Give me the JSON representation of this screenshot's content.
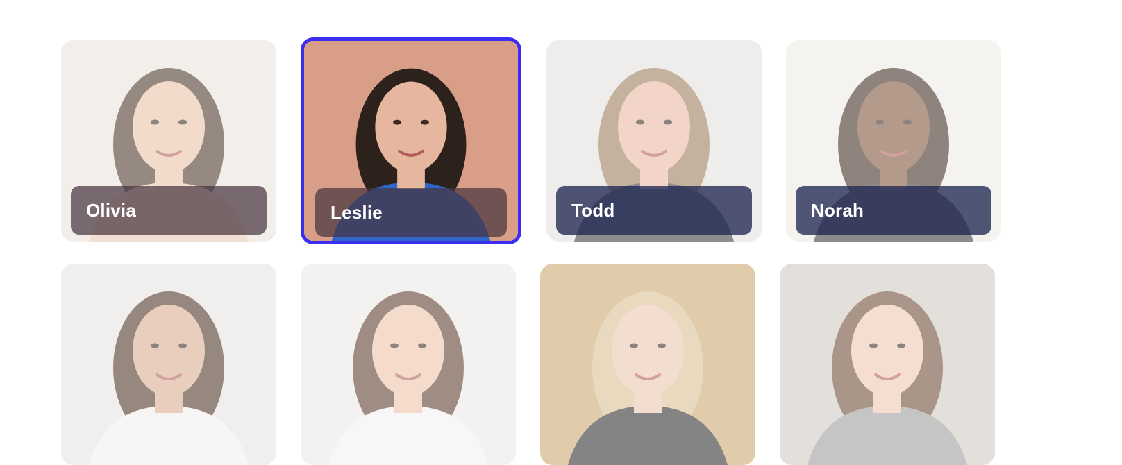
{
  "avatars": [
    {
      "name": "Olivia",
      "selected": false,
      "bg": "#e9e3dd",
      "hair": "#4a3426",
      "skin": "#e9c2a6",
      "top": "#e8cbb3"
    },
    {
      "name": "Leslie",
      "selected": true,
      "bg": "#d99e87",
      "hair": "#2d211b",
      "skin": "#e7b69e",
      "top": "#2f66c8"
    },
    {
      "name": "Todd",
      "selected": false,
      "bg": "#e3e1dc",
      "hair": "#9a7b59",
      "skin": "#e9b7a0",
      "top": "#3c3c3c"
    },
    {
      "name": "Norah",
      "selected": false,
      "bg": "#ecebe6",
      "hair": "#3d2b1f",
      "skin": "#7d5138",
      "top": "#3a3836"
    },
    {
      "name": "",
      "selected": false,
      "bg": "#e7e4e0",
      "hair": "#4b3323",
      "skin": "#d9ab8e",
      "top": "#f2f0ec"
    },
    {
      "name": "",
      "selected": false,
      "bg": "#ece9e5",
      "hair": "#5a3a2a",
      "skin": "#edc1a8",
      "top": "#f2f2f2"
    },
    {
      "name": "",
      "selected": false,
      "bg": "#caa76e",
      "hair": "#d9be8f",
      "skin": "#e9c4ad",
      "top": "#2b2b2b"
    },
    {
      "name": "",
      "selected": false,
      "bg": "#cfc8bf",
      "hair": "#6b4a34",
      "skin": "#eec6ac",
      "top": "#9b9b9b"
    }
  ],
  "colors": {
    "selected_border": "#3b2ef0",
    "name_bar": "#202852"
  }
}
